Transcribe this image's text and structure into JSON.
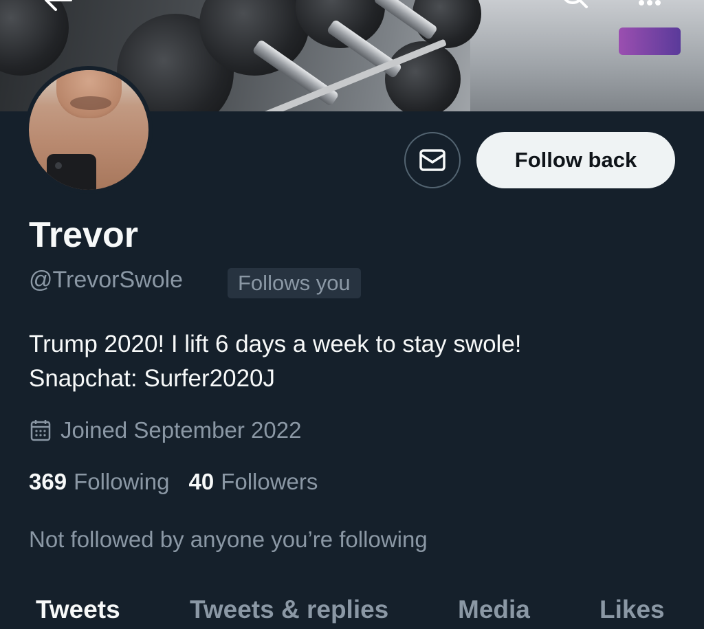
{
  "header": {
    "back_icon": "back-arrow-icon",
    "search_icon": "search-icon",
    "more_icon": "more-icon"
  },
  "profile": {
    "name": "Trevor",
    "handle": "@TrevorSwole",
    "follows_you_badge": "Follows you",
    "bio_line1": "Trump 2020! I lift 6 days a week to stay swole!",
    "bio_line2": "Snapchat: Surfer2020J",
    "joined": "Joined September 2022",
    "following_count": "369",
    "following_label": "Following",
    "followers_count": "40",
    "followers_label": "Followers",
    "not_followed_text": "Not followed by anyone you’re following"
  },
  "actions": {
    "message_icon": "mail-icon",
    "follow_back_label": "Follow back"
  },
  "tabs": [
    {
      "label": "Tweets",
      "active": true
    },
    {
      "label": "Tweets & replies",
      "active": false
    },
    {
      "label": "Media",
      "active": false
    },
    {
      "label": "Likes",
      "active": false
    }
  ],
  "colors": {
    "background": "#15202b",
    "primary_text": "#f7f9f9",
    "secondary_text": "#8b98a5",
    "button_bg": "#eff3f4"
  }
}
